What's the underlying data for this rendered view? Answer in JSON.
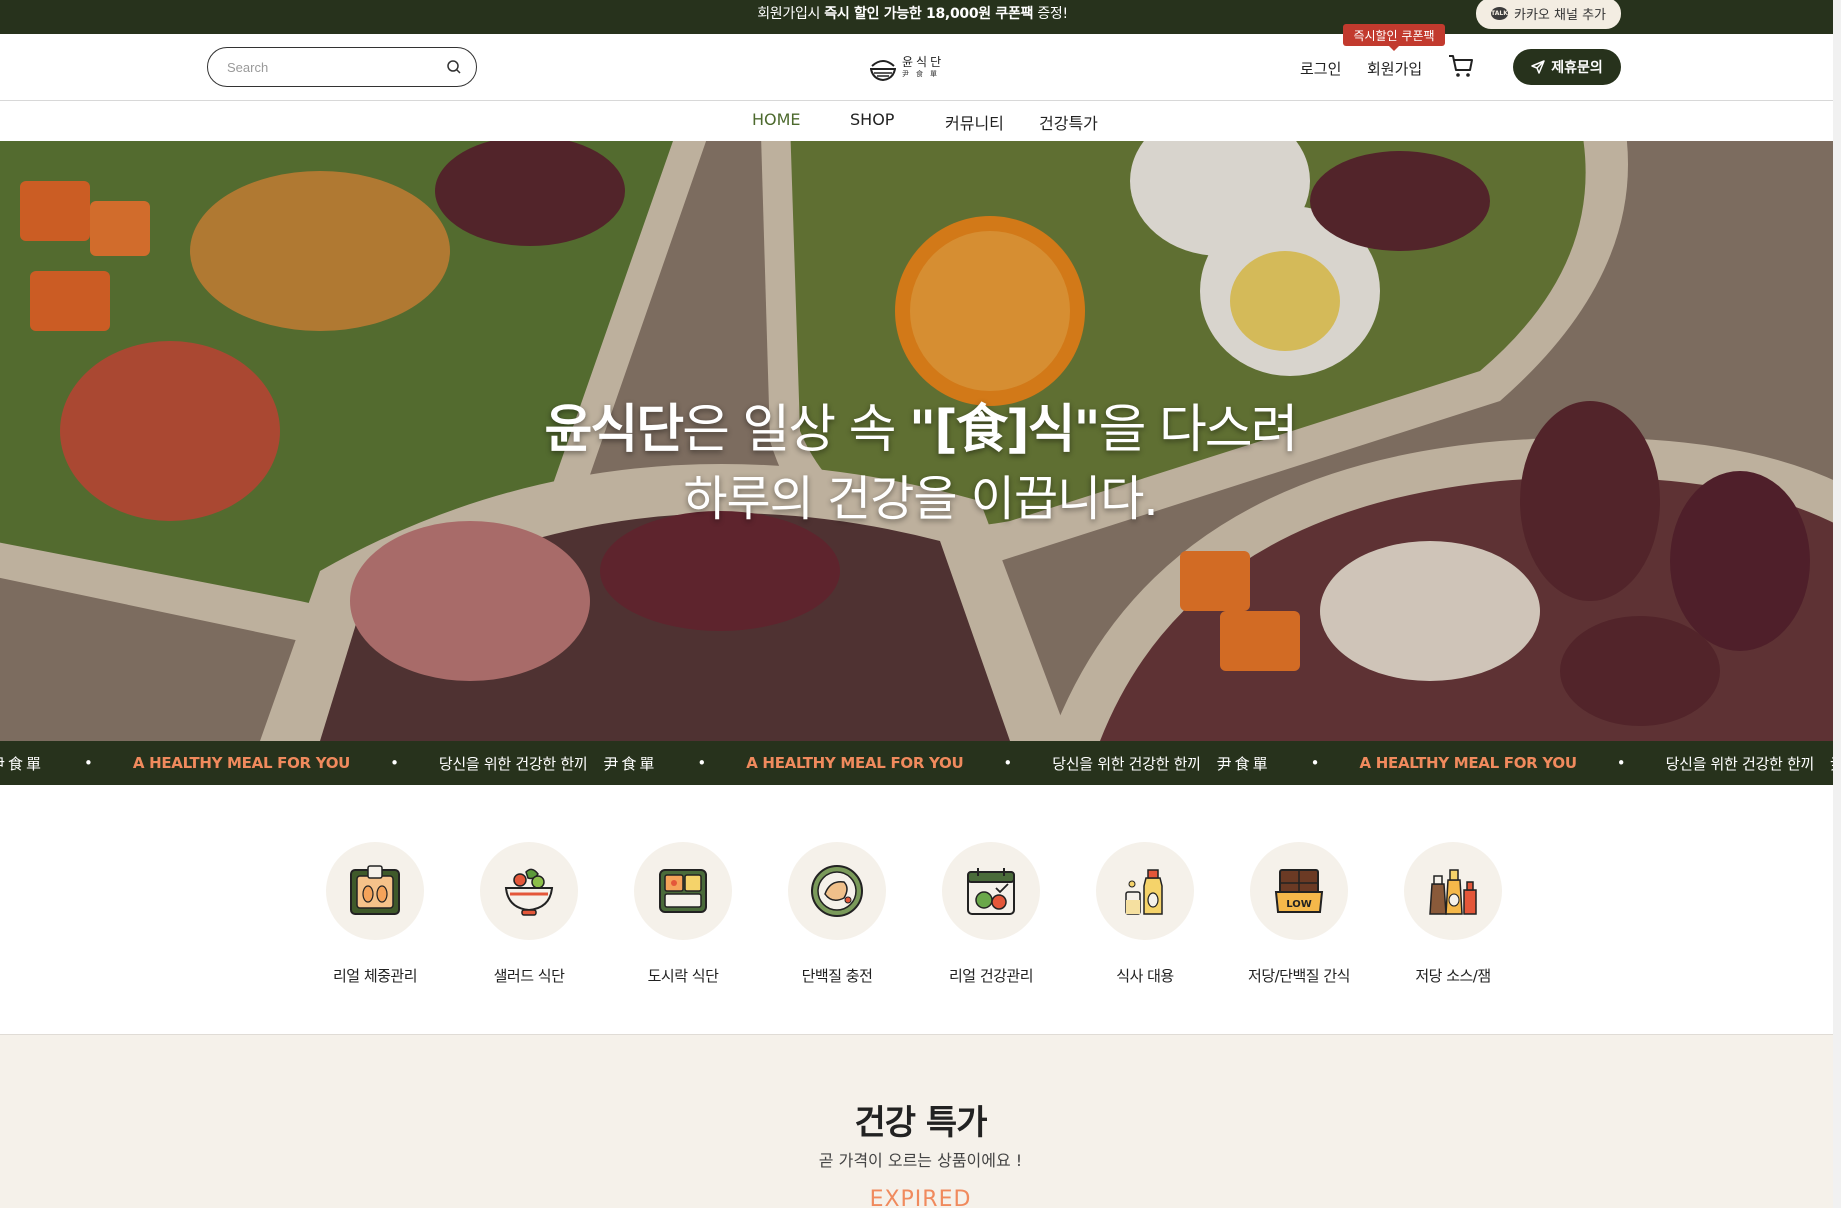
{
  "top_banner": {
    "prefix": "회원가입시 ",
    "highlight": "즉시 할인 가능한 18,000원 쿠폰팩",
    "suffix": " 증정!",
    "kakao_button": "카카오 채널 추가",
    "kakao_icon_text": "TALK"
  },
  "header": {
    "search_placeholder": "Search",
    "logo_ko": "윤식단",
    "logo_hanja": "尹食單",
    "login": "로그인",
    "join": "회원가입",
    "coupon_badge": "즉시할인 쿠폰팩",
    "partner_button": "제휴문의"
  },
  "nav": {
    "items": [
      {
        "label": "HOME",
        "active": true
      },
      {
        "label": "SHOP",
        "active": false
      },
      {
        "label": "커뮤니티",
        "active": false
      },
      {
        "label": "건강특가",
        "active": false
      }
    ]
  },
  "hero": {
    "line1_bold": "윤식단",
    "line1_mid": "은 일상 속 ",
    "line1_quote": "\"[食]식\"",
    "line1_end": "을 다스려",
    "line2": "하루의 건강을 이끕니다."
  },
  "marquee": {
    "hanja": "尹食單",
    "english": "A HEALTHY MEAL FOR YOU",
    "korean": "당신을 위한 건강한 한끼",
    "dot": "•"
  },
  "categories": [
    {
      "label": "리얼 체중관리",
      "icon": "scale-icon"
    },
    {
      "label": "샐러드 식단",
      "icon": "salad-bowl-icon"
    },
    {
      "label": "도시락 식단",
      "icon": "lunchbox-icon"
    },
    {
      "label": "단백질 충전",
      "icon": "protein-plate-icon"
    },
    {
      "label": "리얼 건강관리",
      "icon": "calendar-veg-icon"
    },
    {
      "label": "식사 대용",
      "icon": "shake-bottle-icon"
    },
    {
      "label": "저당/단백질 간식",
      "icon": "chocolate-low-icon"
    },
    {
      "label": "저당 소스/잼",
      "icon": "sauce-jars-icon"
    }
  ],
  "special": {
    "title": "건강 특가",
    "subtitle": "곧 가격이 오르는 상품이에요 !",
    "status": "EXPIRED"
  },
  "colors": {
    "brand_dark": "#27321c",
    "accent_orange": "#f08a5d",
    "badge_red": "#c23a2e",
    "nav_active": "#4d6a2e",
    "cream": "#f5f1ea"
  }
}
